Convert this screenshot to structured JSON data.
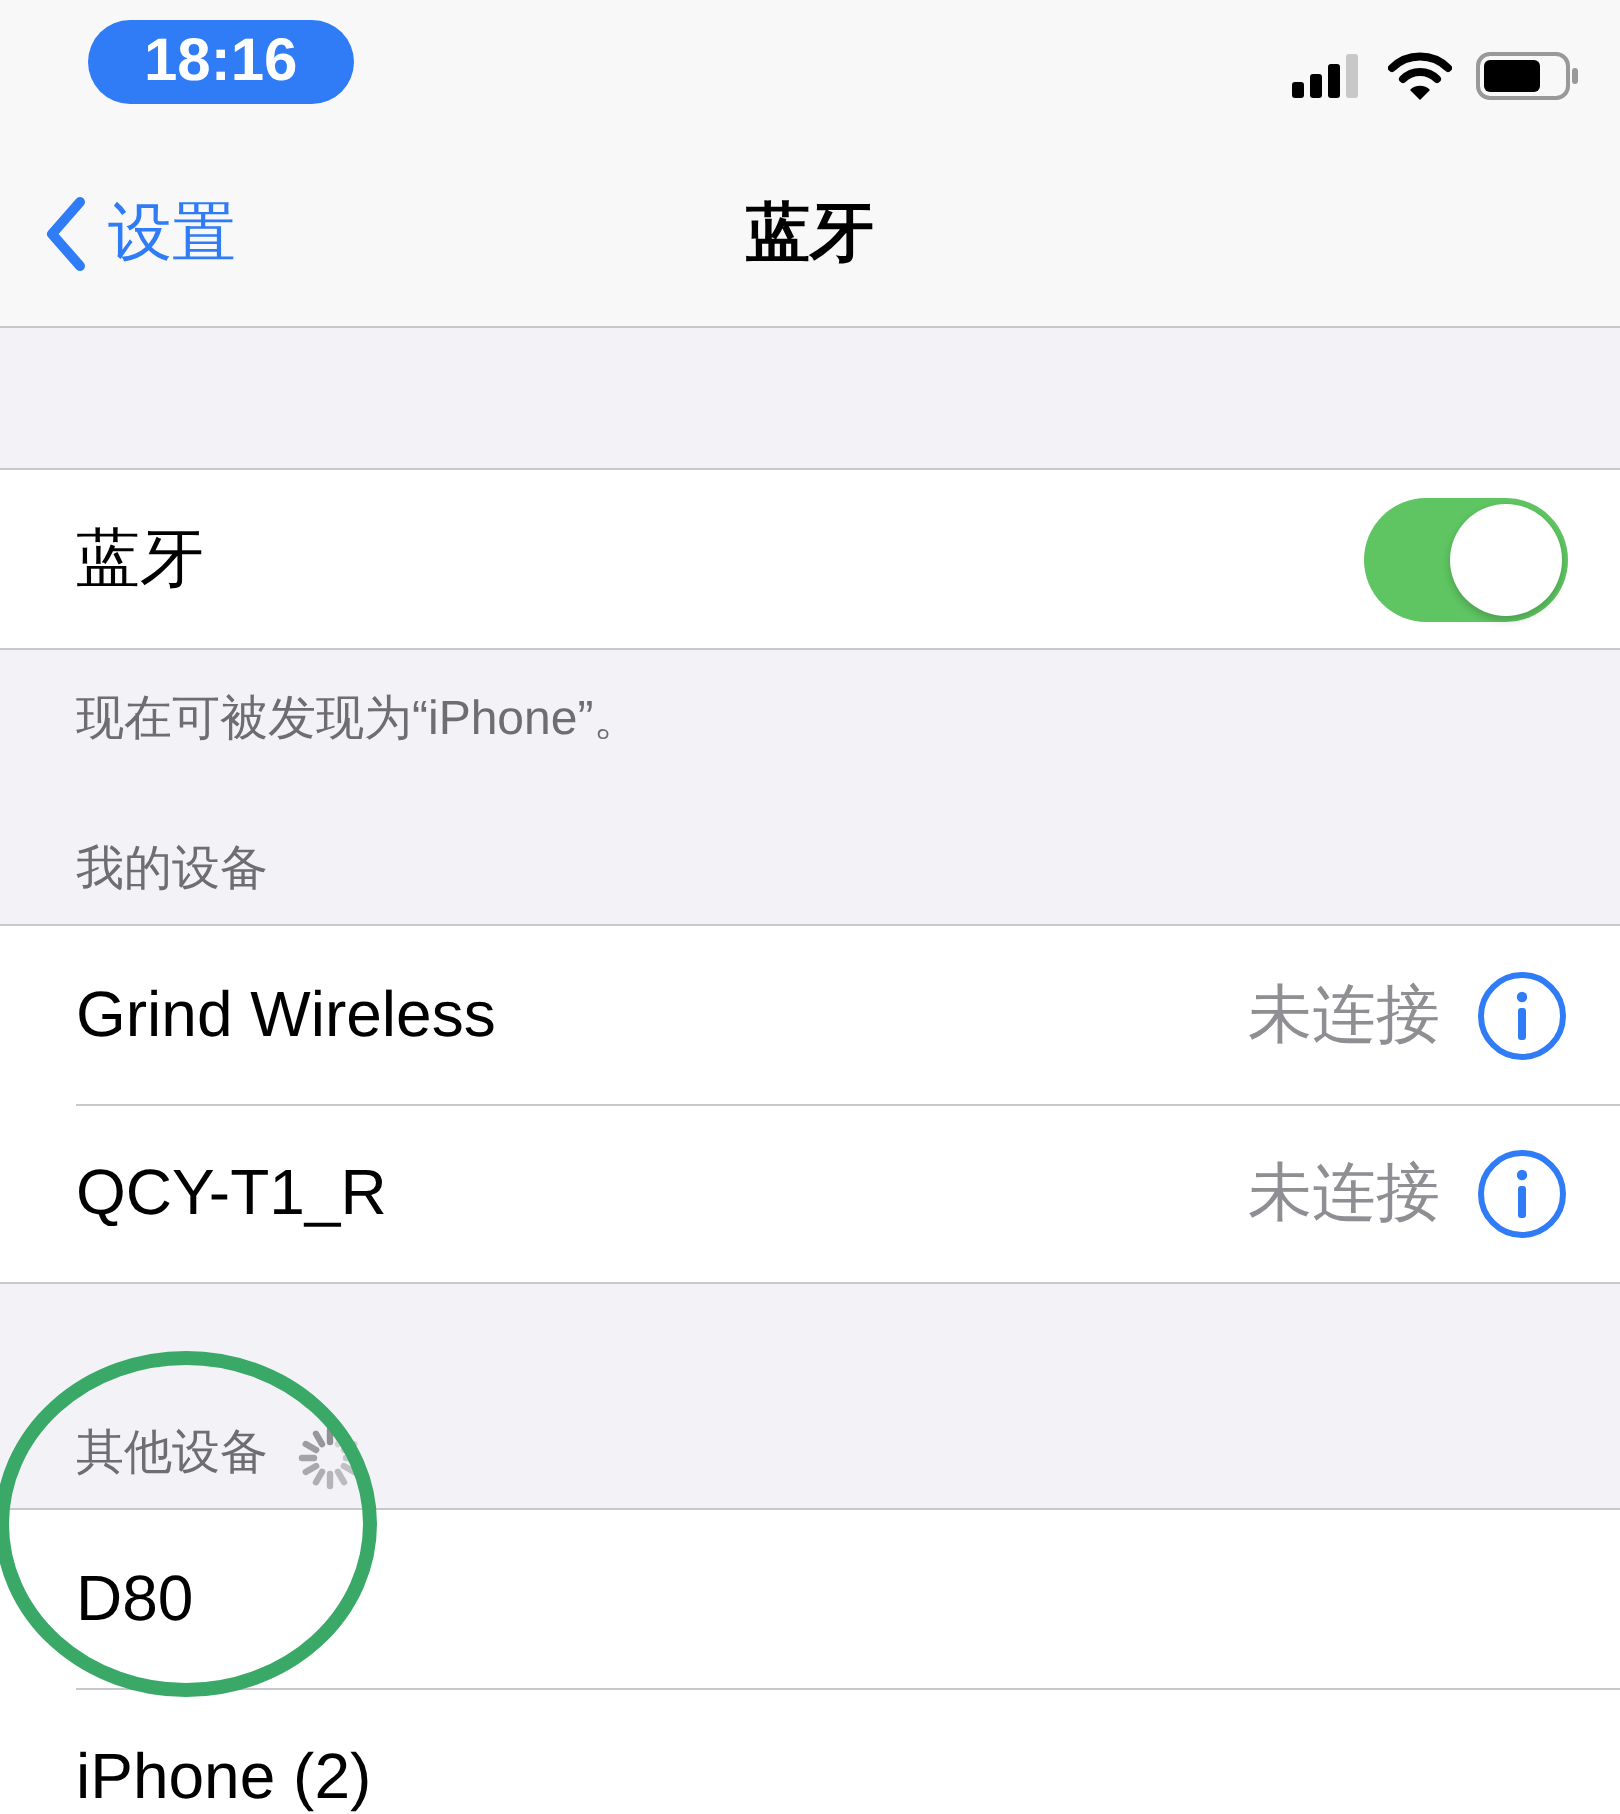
{
  "status_bar": {
    "time": "18:16"
  },
  "nav": {
    "back": "设置",
    "title": "蓝牙"
  },
  "bluetooth": {
    "label": "蓝牙",
    "on": true,
    "footer": "现在可被发现为“iPhone”。"
  },
  "sections": [
    {
      "header": "我的设备",
      "scanning": false,
      "devices": [
        {
          "name": "Grind Wireless",
          "status": "未连接",
          "info": true
        },
        {
          "name": "QCY-T1_R",
          "status": "未连接",
          "info": true
        }
      ]
    },
    {
      "header": "其他设备",
      "scanning": true,
      "devices": [
        {
          "name": "D80",
          "info": false
        },
        {
          "name": "iPhone (2)",
          "info": false
        }
      ]
    }
  ],
  "annotations": [
    {
      "kind": "circle"
    }
  ]
}
